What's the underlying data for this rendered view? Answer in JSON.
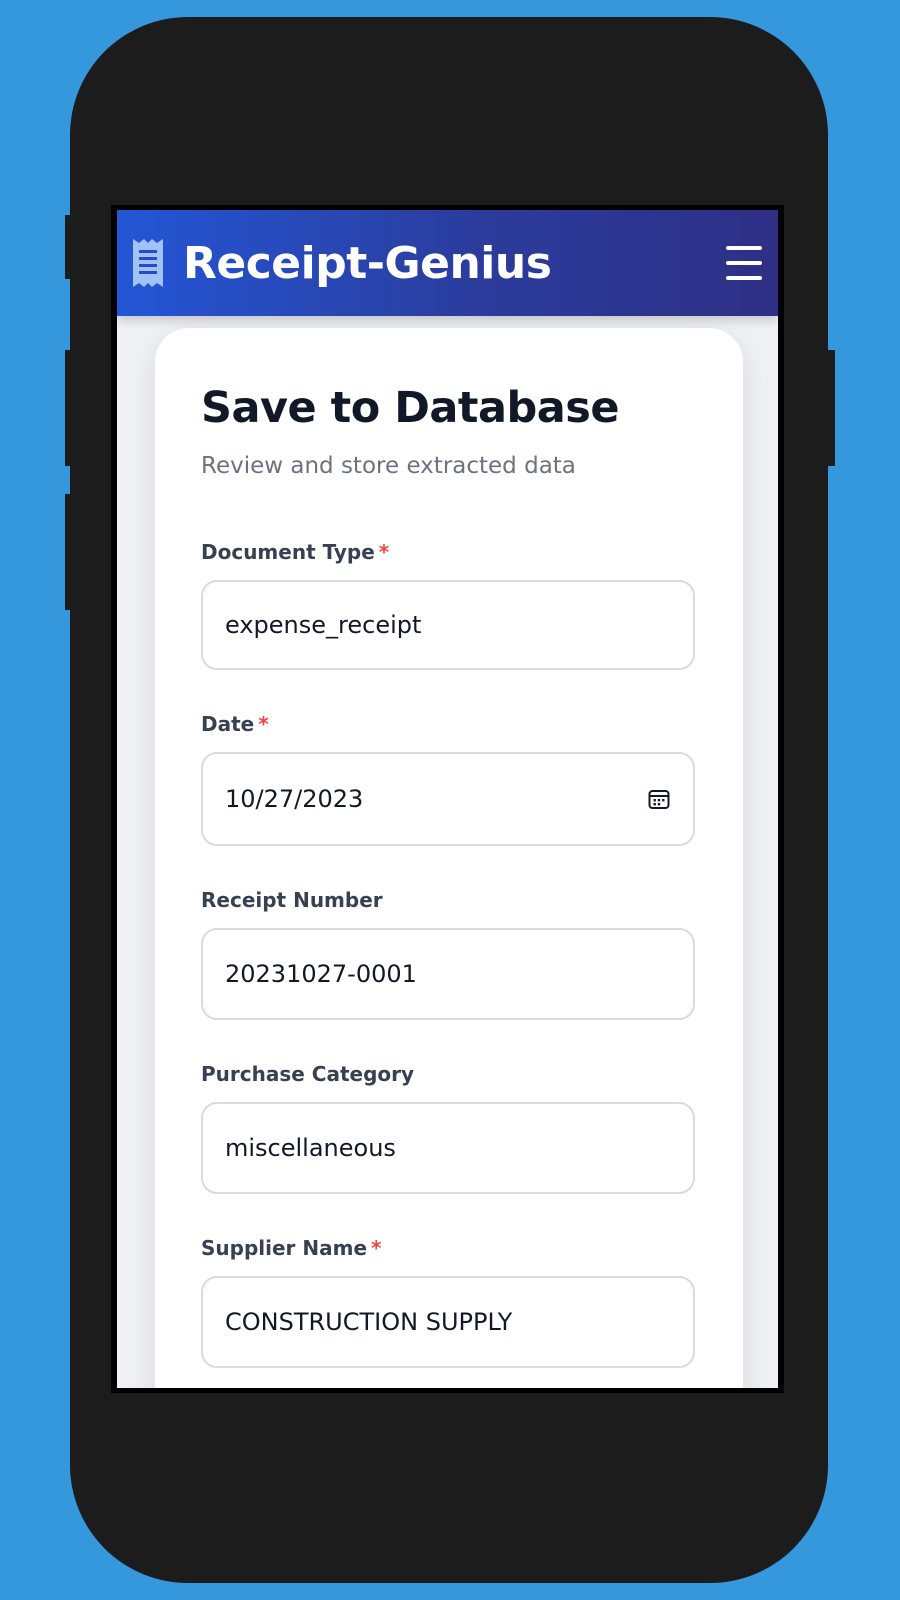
{
  "app": {
    "title": "Receipt-Genius",
    "logo_icon": "receipt-icon",
    "menu_icon": "hamburger-menu-icon",
    "header_gradient": [
      "#2456d6",
      "#2e2f86"
    ]
  },
  "form": {
    "title": "Save to Database",
    "subtitle": "Review and store extracted data",
    "required_marker": "*",
    "fields": [
      {
        "label": "Document Type",
        "required": true,
        "value": "expense_receipt",
        "icon": null
      },
      {
        "label": "Date",
        "required": true,
        "value": "10/27/2023",
        "icon": "calendar-icon"
      },
      {
        "label": "Receipt Number",
        "required": false,
        "value": "20231027-0001",
        "icon": null
      },
      {
        "label": "Purchase Category",
        "required": false,
        "value": "miscellaneous",
        "icon": null
      },
      {
        "label": "Supplier Name",
        "required": true,
        "value": "CONSTRUCTION SUPPLY",
        "icon": null
      }
    ]
  },
  "colors": {
    "background": "#3598dc",
    "device": "#1c1c1c",
    "required": "#ef4444"
  }
}
